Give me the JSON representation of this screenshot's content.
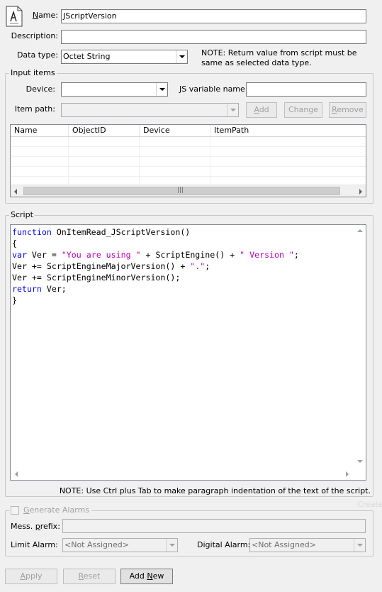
{
  "header": {
    "icon": "script-document-icon",
    "name_label_pre": "",
    "name_label_u": "N",
    "name_label_post": "ame:",
    "name_value": "JScriptVersion",
    "description_label": "Description:",
    "description_value": "",
    "datatype_label": "Data type:",
    "datatype_value": "Octet String",
    "note": "NOTE: Return value from script must be same as selected data type."
  },
  "input_items": {
    "title": "Input items",
    "device_label": "Device:",
    "device_value": "",
    "js_var_label": "JS variable name:",
    "js_var_value": "",
    "item_path_label": "Item path:",
    "item_path_value": "",
    "add_label_u": "A",
    "add_label_post": "dd",
    "change_label": "Change",
    "remove_label_u": "R",
    "remove_label_post": "emove",
    "columns": [
      "Name",
      "ObjectID",
      "Device",
      "ItemPath"
    ],
    "rows": [],
    "scroll_grip": "|||"
  },
  "script": {
    "title": "Script",
    "lines": [
      [
        {
          "t": "function",
          "c": "kw"
        },
        {
          "t": " OnItemRead_JScriptVersion()",
          "c": ""
        }
      ],
      [
        {
          "t": "{",
          "c": ""
        }
      ],
      [
        {
          "t": "var",
          "c": "kw"
        },
        {
          "t": " Ver = ",
          "c": ""
        },
        {
          "t": "\"You are using \"",
          "c": "str"
        },
        {
          "t": " + ScriptEngine() + ",
          "c": ""
        },
        {
          "t": "\" Version \"",
          "c": "str"
        },
        {
          "t": ";",
          "c": ""
        }
      ],
      [
        {
          "t": "Ver += ScriptEngineMajorVersion() + ",
          "c": ""
        },
        {
          "t": "\".\"",
          "c": "str"
        },
        {
          "t": ";",
          "c": ""
        }
      ],
      [
        {
          "t": "Ver += ScriptEngineMinorVersion();",
          "c": ""
        }
      ],
      [
        {
          "t": "return",
          "c": "kw"
        },
        {
          "t": " Ver;",
          "c": ""
        }
      ],
      [
        {
          "t": "}",
          "c": ""
        }
      ]
    ],
    "note": "NOTE: Use Ctrl plus Tab to make paragraph indentation of the text of the script."
  },
  "alarms": {
    "generate_label_pre": "",
    "generate_label_u": "G",
    "generate_label_post": "enerate Alarms",
    "generate_checked": false,
    "prefix_label_pre": "Mess. ",
    "prefix_label_u": "p",
    "prefix_label_post": "refix:",
    "prefix_value": "",
    "limit_label": "Limit Alarm:",
    "limit_value": "<Not Assigned>",
    "digital_label": "Digital Alarm:",
    "digital_value": "<Not Assigned>"
  },
  "footer": {
    "apply_label_u": "A",
    "apply_label_post": "pply",
    "reset_label_u": "R",
    "reset_label_post": "eset",
    "addnew_label_pre": "Add ",
    "addnew_label_u": "N",
    "addnew_label_post": "ew",
    "watermark": "Create"
  }
}
